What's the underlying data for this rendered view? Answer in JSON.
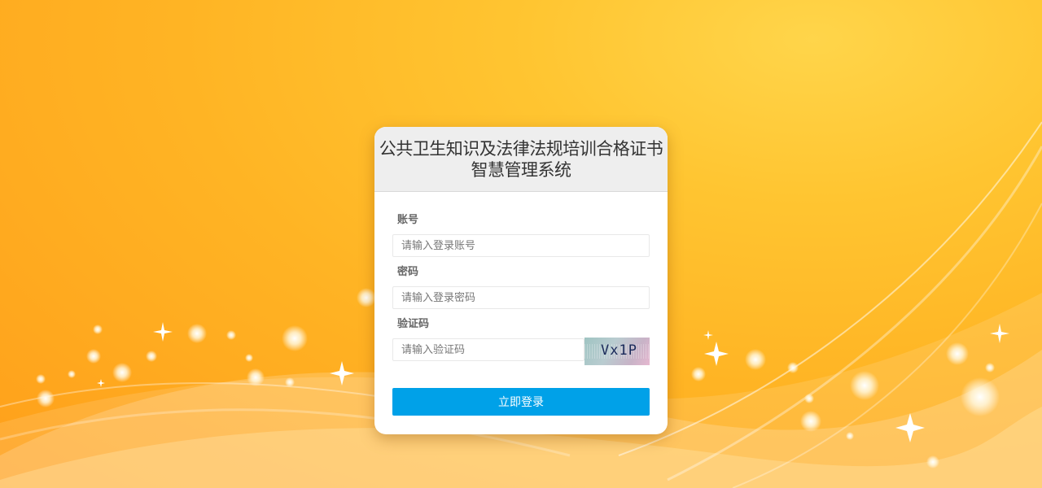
{
  "login": {
    "title_line1": "公共卫生知识及法律法规培训合格证书",
    "title_line2": "智慧管理系统",
    "account": {
      "label": "账号",
      "placeholder": "请输入登录账号",
      "value": ""
    },
    "password": {
      "label": "密码",
      "placeholder": "请输入登录密码",
      "value": ""
    },
    "captcha": {
      "label": "验证码",
      "placeholder": "请输入验证码",
      "value": "",
      "image_text": "Vx1P"
    },
    "submit_label": "立即登录"
  },
  "colors": {
    "background": "#ffb424",
    "button": "#00a1e8",
    "card": "#ffffff",
    "header": "#eeeeee"
  }
}
